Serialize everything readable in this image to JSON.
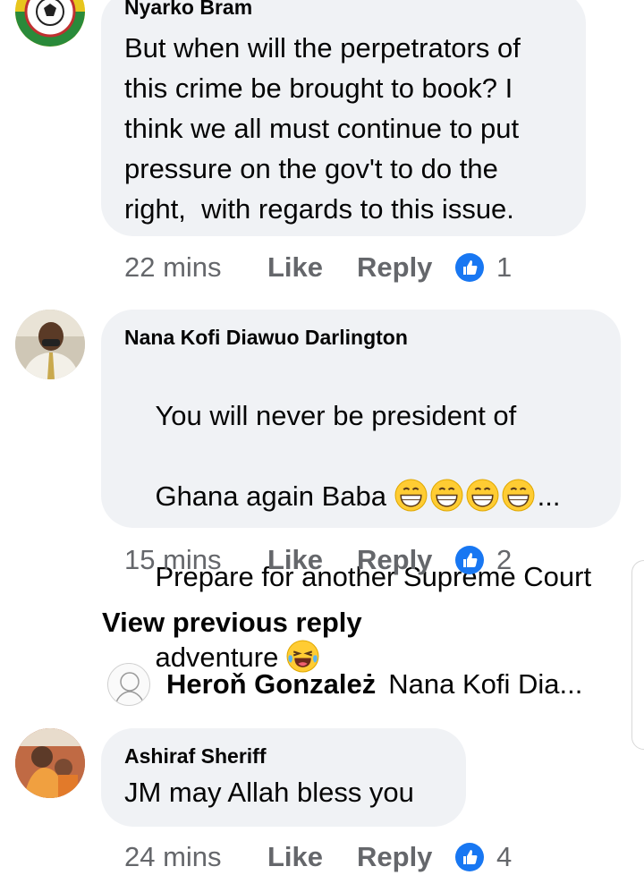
{
  "comments": [
    {
      "author": "Nyarko Bram",
      "text": "But when will the perpetrators of\nthis crime be brought to book? I\nthink we all must continue to put\npressure on the gov't to do the\nright,  with regards to this issue.",
      "time": "22 mins",
      "like_label": "Like",
      "reply_label": "Reply",
      "reaction_count": "1"
    },
    {
      "author": "Nana Kofi Diawuo Darlington",
      "line1": "You will never be president of",
      "line2a": "Ghana again Baba ",
      "line2b": "...",
      "line3": "Prepare for another Supreme Court",
      "line4": "adventure ",
      "time": "15 mins",
      "like_label": "Like",
      "reply_label": "Reply",
      "reaction_count": "2"
    },
    {
      "author": "Ashiraf Sheriff",
      "text": "JM may Allah bless you",
      "time": "24 mins",
      "like_label": "Like",
      "reply_label": "Reply",
      "reaction_count": "4"
    }
  ],
  "view_previous_reply": "View previous reply",
  "reply_preview": {
    "name": "Heroň Gonzależ",
    "text": "Nana Kofi Dia..."
  },
  "colors": {
    "bubble": "#f0f2f5",
    "secondary_text": "#65676b",
    "like_blue": "#1877f2"
  }
}
